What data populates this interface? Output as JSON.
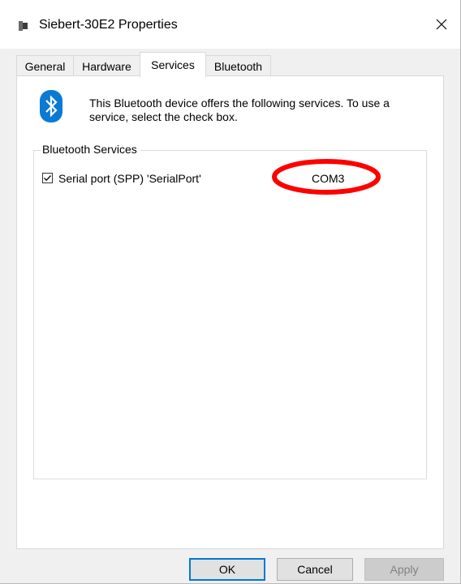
{
  "window": {
    "title": "Siebert-30E2 Properties"
  },
  "tabs": [
    {
      "label": "General",
      "active": false
    },
    {
      "label": "Hardware",
      "active": false
    },
    {
      "label": "Services",
      "active": true
    },
    {
      "label": "Bluetooth",
      "active": false
    }
  ],
  "services_tab": {
    "intro_text": "This Bluetooth device offers the following services. To use a service, select the check box.",
    "group_label": "Bluetooth Services",
    "services": [
      {
        "label": "Serial port (SPP) 'SerialPort'",
        "checked": true,
        "port": "COM3"
      }
    ]
  },
  "buttons": {
    "ok": "OK",
    "cancel": "Cancel",
    "apply": "Apply"
  },
  "icons": {
    "title": "device-icon",
    "close": "close-icon",
    "bluetooth": "bluetooth-icon",
    "checkbox": "checkmark-icon"
  },
  "colors": {
    "bluetooth_blue": "#0a7ad4",
    "annotation_red": "#ff0000",
    "default_button_border": "#0078d7"
  }
}
